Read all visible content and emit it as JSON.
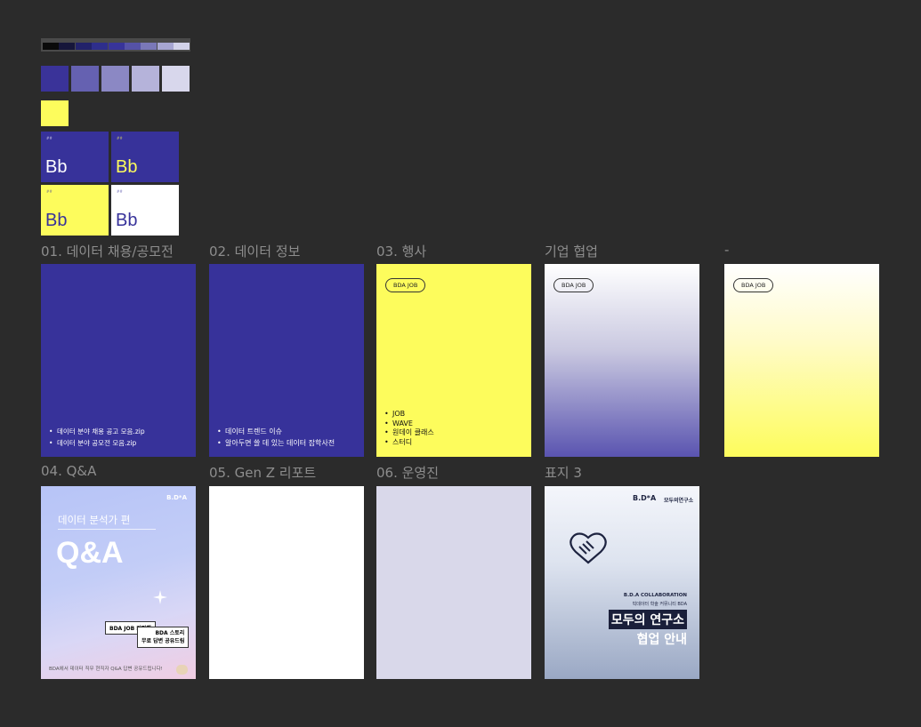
{
  "colors": {
    "strip": [
      "#0a0a0a",
      "#16163a",
      "#22226a",
      "#2e2e8c",
      "#38349a",
      "#5552a6",
      "#7a78b8",
      "#a7a6d2",
      "#d3d3ea"
    ],
    "swatches": [
      "#3a3399",
      "#6561b1",
      "#8b88c4",
      "#b5b3da",
      "#d8d7ec"
    ],
    "yellow": "#fdfc5c",
    "navy": "#37329a"
  },
  "type_tiles": [
    {
      "small": "##",
      "text": "Bb"
    },
    {
      "small": "##",
      "text": "Bb"
    },
    {
      "small": "##",
      "text": "Bb"
    },
    {
      "small": "##",
      "text": "Bb"
    }
  ],
  "sections": {
    "s01": {
      "label": "01. 데이터 채용/공모전",
      "bullets": [
        "데이터 분야 채용 공고 모음.zip",
        "데이터 분야 공모전 모음.zip"
      ]
    },
    "s02": {
      "label": "02. 데이터 정보",
      "bullets": [
        "데이터 트렌드 이슈",
        "알아두면 쓸 데 있는 데이터 잡학사전"
      ]
    },
    "s03": {
      "label": "03. 행사",
      "pill": "BDA JOB",
      "bullets": [
        "JOB",
        "WAVE",
        "원데이 클래스",
        "스터디"
      ]
    },
    "corp": {
      "label": "기업 협업",
      "pill": "BDA JOB"
    },
    "dash": {
      "label": "-",
      "pill": "BDA JOB"
    },
    "s04": {
      "label": "04. Q&A",
      "logo": "B.D*A",
      "subtitle": "데이터 분석가 편",
      "title": "Q&A",
      "tag1": "BDA JOB 커피챗",
      "tag2": "BDA 스토리\n무료 답변 공유드림",
      "footer": "BDA에서 데이터 직무 현직자 Q&A 답변 공유드립니다!"
    },
    "s05": {
      "label": "05. Gen Z 리포트"
    },
    "s06": {
      "label": "06. 운영진"
    },
    "cover3": {
      "label": "표지 3",
      "logo": "B.D*A",
      "logo2": "모두의연구소",
      "collab": "B.D.A COLLABORATION",
      "sub": "빅데이터 학술 커뮤니티 BDA",
      "title1": "모두의 연구소",
      "title2": "협업 안내"
    }
  }
}
